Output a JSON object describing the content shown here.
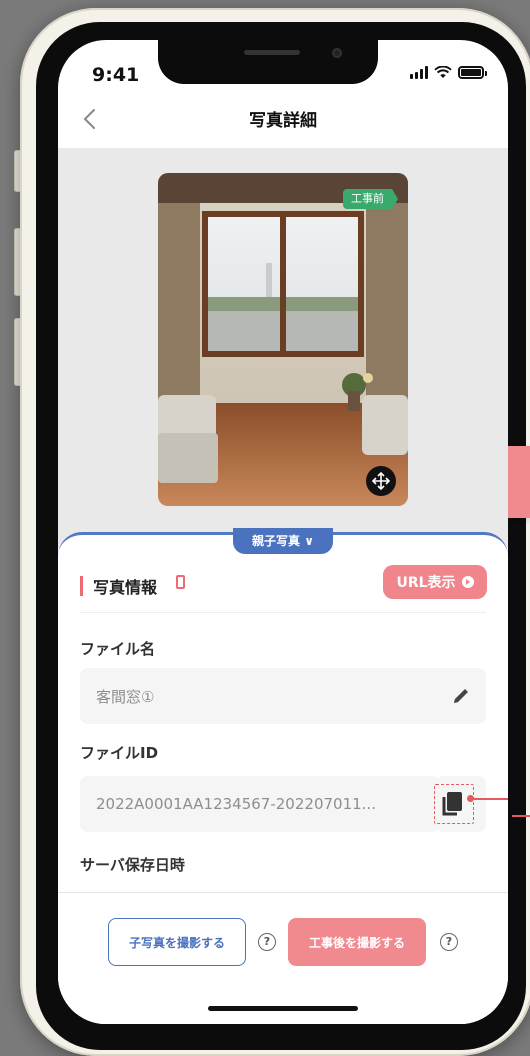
{
  "status_bar": {
    "time": "9:41"
  },
  "nav": {
    "title": "写真詳細",
    "back_label": "<"
  },
  "photo": {
    "tag": "工事前"
  },
  "tabs": {
    "parent_photo": "親子写真 ∨"
  },
  "section": {
    "title": "写真情報",
    "url_button": "URL表示"
  },
  "fields": {
    "file_name": {
      "label": "ファイル名",
      "value": "客間窓①"
    },
    "file_id": {
      "label": "ファイルID",
      "value": "2022A0001AA1234567-202207011..."
    },
    "server_saved": {
      "label": "サーバ保存日時"
    }
  },
  "actions": {
    "take_child": "子写真を撮影する",
    "take_after": "工事後を撮影する",
    "help": "?"
  },
  "colors": {
    "accent_blue": "#4a72bf",
    "accent_pink": "#f08a8f",
    "tag_green": "#3aaa6c"
  }
}
